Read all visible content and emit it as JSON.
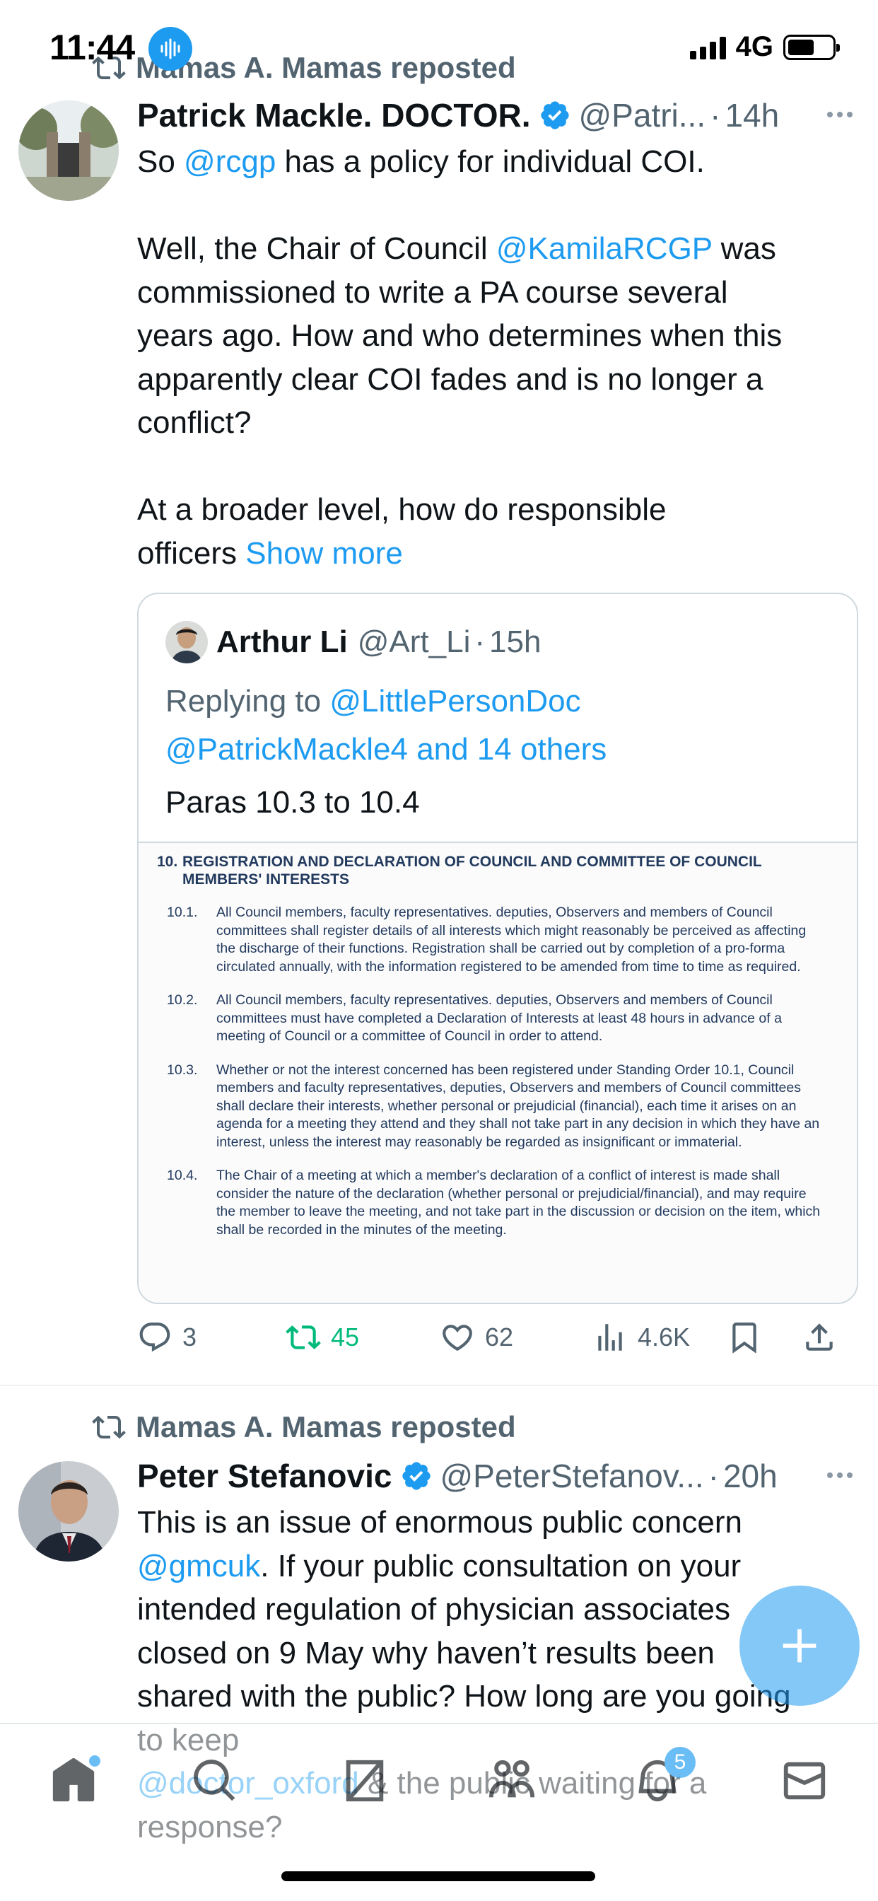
{
  "status_bar": {
    "time": "11:44",
    "network": "4G",
    "icons": [
      "voice-memo-icon",
      "signal-icon",
      "battery-icon"
    ]
  },
  "tweets": [
    {
      "reposted_by": "Mamas A. Mamas reposted",
      "name": "Patrick Mackle. DOCTOR.",
      "handle": "@Patri...",
      "dot": "·",
      "time": "14h",
      "body": [
        [
          {
            "t": "So "
          },
          {
            "t": "@rcgp",
            "link": true
          },
          {
            "t": " has a policy for individual COI."
          }
        ],
        [],
        [
          {
            "t": "Well, the Chair of Council "
          },
          {
            "t": "@KamilaRCGP",
            "link": true
          },
          {
            "t": " was"
          }
        ],
        [
          {
            "t": "commissioned to write a PA course several"
          }
        ],
        [
          {
            "t": "years ago.  How and who determines when this"
          }
        ],
        [
          {
            "t": "apparently clear COI fades and is no longer a"
          }
        ],
        [
          {
            "t": "conflict?"
          }
        ],
        [],
        [
          {
            "t": "At a broader level, how do responsible"
          }
        ],
        [
          {
            "t": "officers "
          },
          {
            "t": "Show more",
            "link": true
          }
        ]
      ],
      "quote": {
        "name": "Arthur Li",
        "handle": "@Art_Li",
        "dot": "·",
        "time": "15h",
        "replying_prefix": "Replying to ",
        "replying_line1": "@LittlePersonDoc",
        "replying_line2": "@PatrickMackle4 and 14 others",
        "text": "Paras 10.3 to 10.4",
        "document": {
          "title_num": "10.",
          "title": "REGISTRATION AND DECLARATION OF COUNCIL AND COMMITTEE OF COUNCIL MEMBERS' INTERESTS",
          "paragraphs": [
            {
              "num": "10.1.",
              "text": "All Council members, faculty representatives. deputies, Observers and members of Council committees shall register details of all interests which might reasonably be perceived as affecting the discharge of their functions. Registration shall be carried out by completion of a pro-forma circulated annually, with the information registered to be amended from time to time as required."
            },
            {
              "num": "10.2.",
              "text": "All Council members, faculty representatives. deputies, Observers and members of Council committees must have completed a Declaration of Interests at least 48 hours in advance of a meeting of Council or a committee of Council in order to attend."
            },
            {
              "num": "10.3.",
              "text": "Whether or not the interest concerned has been registered under Standing Order 10.1, Council members and faculty representatives, deputies, Observers and members of Council committees shall declare their interests, whether personal or prejudicial (financial), each time it arises on an agenda for a meeting they attend and they shall not take part in any decision in which they have an interest, unless the interest may reasonably be regarded as insignificant or immaterial."
            },
            {
              "num": "10.4.",
              "text": "The Chair of a meeting at which a member's declaration of a conflict of interest is made shall consider the nature of the declaration (whether personal or prejudicial/financial), and may require the member to leave the meeting, and not take part in the discussion or decision on the item, which shall be recorded in the minutes of the meeting."
            }
          ]
        }
      },
      "stats": {
        "replies": "3",
        "reposts": "45",
        "likes": "62",
        "views": "4.6K"
      }
    },
    {
      "reposted_by": "Mamas A. Mamas reposted",
      "name": "Peter Stefanovic",
      "handle": "@PeterStefanov...",
      "dot": "·",
      "time": "20h",
      "body": [
        [
          {
            "t": "This is an issue of enormous public concern"
          }
        ],
        [
          {
            "t": "@gmcuk",
            "link": true
          },
          {
            "t": ". If your public consultation on your"
          }
        ],
        [
          {
            "t": "intended regulation of physician associates"
          }
        ],
        [
          {
            "t": "closed on 9 May why haven’t results been"
          }
        ],
        [
          {
            "t": "shared with the public? How long are you going"
          }
        ],
        [
          {
            "t": "to keep"
          }
        ],
        [
          {
            "t": " "
          },
          {
            "t": "@doctor_oxford",
            "link": true
          },
          {
            "t": " & the public waiting for a"
          }
        ],
        [
          {
            "t": "response?"
          }
        ]
      ]
    }
  ],
  "bottom_nav": {
    "items": [
      "home-icon",
      "search-icon",
      "grok-icon",
      "communities-icon",
      "notifications-icon",
      "messages-icon"
    ],
    "notifications_badge": "5"
  },
  "colors": {
    "accent": "#1d9bf0",
    "secondary_text": "#536471",
    "repost_green": "#00ba7c"
  }
}
